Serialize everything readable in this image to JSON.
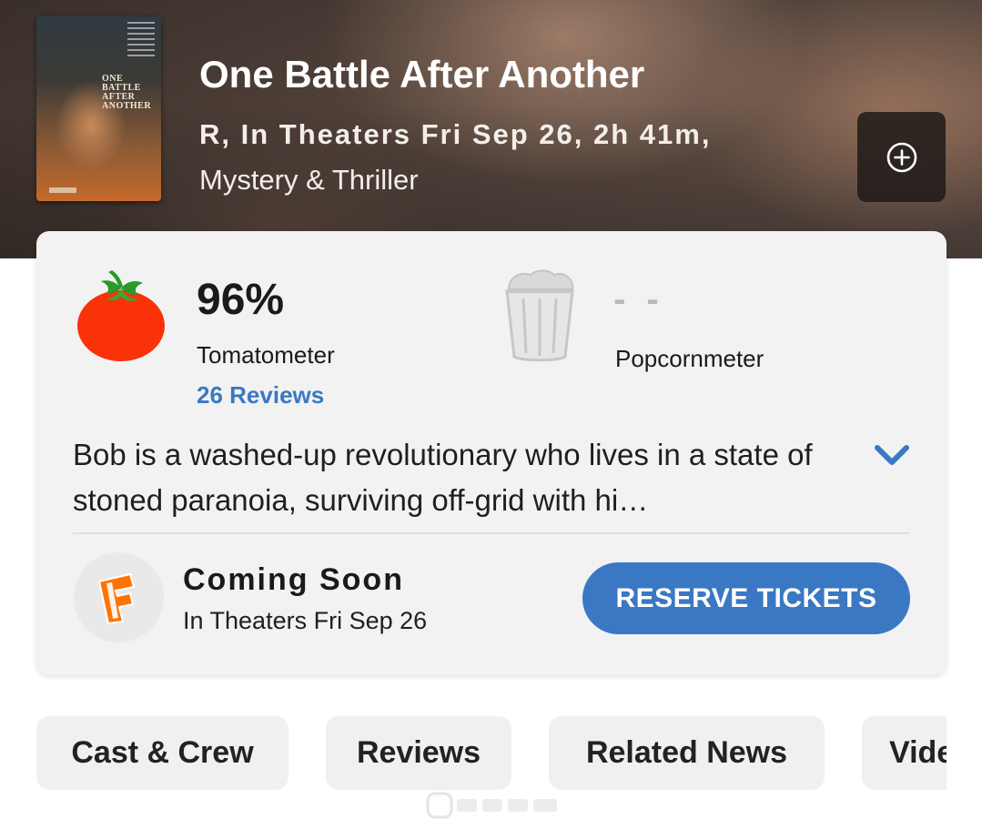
{
  "hero": {
    "title": "One Battle After Another",
    "meta": "R, In Theaters Fri Sep 26, 2h 41m,",
    "genre": "Mystery & Thriller",
    "poster_text": "ONE\nBATTLE\nAFTER\nANOTHER",
    "add_icon": "plus-circle-icon"
  },
  "scores": {
    "tomatometer": {
      "value": "96%",
      "label": "Tomatometer",
      "reviews": "26 Reviews",
      "icon": "fresh-tomato-icon",
      "color": "#f93208"
    },
    "popcornmeter": {
      "value": "- -",
      "label": "Popcornmeter",
      "icon": "empty-popcorn-bucket-icon"
    }
  },
  "synopsis": {
    "text": "Bob is a washed-up revolutionary who lives in a state of stoned paranoia, surviving off-grid with hi…",
    "expand_icon": "chevron-down-icon"
  },
  "tickets": {
    "logo": "fandango-logo",
    "status": "Coming Soon",
    "date": "In Theaters Fri Sep 26",
    "button_label": "RESERVE TICKETS",
    "button_color": "#3a78c3"
  },
  "tabs": [
    {
      "label": "Cast & Crew"
    },
    {
      "label": "Reviews"
    },
    {
      "label": "Related News"
    },
    {
      "label": "Videos"
    }
  ]
}
